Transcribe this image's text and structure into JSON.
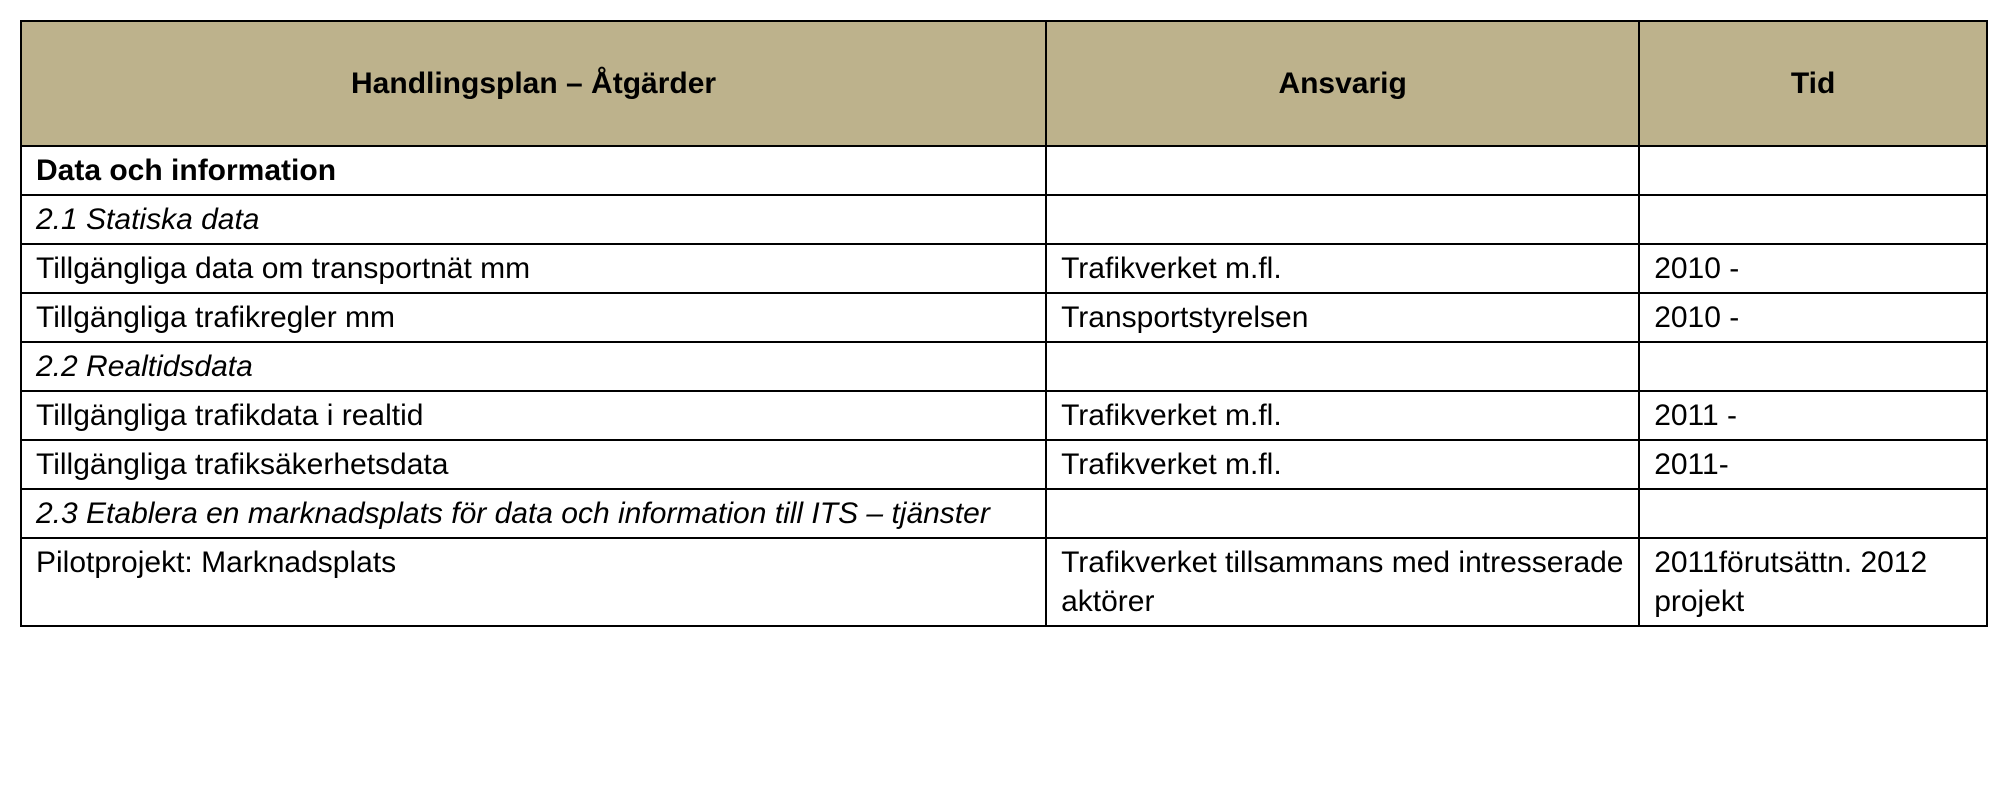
{
  "headers": {
    "col1": "Handlingsplan – Åtgärder",
    "col2": "Ansvarig",
    "col3": "Tid"
  },
  "rows": [
    {
      "c1": "Data och information",
      "c2": "",
      "c3": "",
      "style": "section-title"
    },
    {
      "c1": "2.1 Statiska data",
      "c2": "",
      "c3": "",
      "style": "subsection"
    },
    {
      "c1": "Tillgängliga data om transportnät mm",
      "c2": "Trafikverket m.fl.",
      "c3": "2010 -",
      "style": ""
    },
    {
      "c1": "Tillgängliga trafikregler mm",
      "c2": "Transportstyrelsen",
      "c3": "2010 -",
      "style": ""
    },
    {
      "c1": "2.2 Realtidsdata",
      "c2": "",
      "c3": "",
      "style": "subsection"
    },
    {
      "c1": "Tillgängliga trafikdata i realtid",
      "c2": "Trafikverket m.fl.",
      "c3": "2011 -",
      "style": ""
    },
    {
      "c1": "Tillgängliga trafiksäkerhetsdata",
      "c2": "Trafikverket m.fl.",
      "c3": "2011-",
      "style": ""
    },
    {
      "c1": "2.3 Etablera en marknadsplats för data och information till ITS – tjänster",
      "c2": "",
      "c3": "",
      "style": "subsection"
    },
    {
      "c1": "Pilotprojekt: Marknadsplats",
      "c2": "Trafikverket tillsammans med intresserade aktörer",
      "c3": "2011förutsättn. 2012 projekt",
      "style": ""
    }
  ]
}
